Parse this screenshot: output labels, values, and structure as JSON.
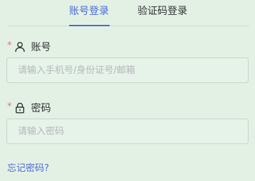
{
  "tabs": [
    {
      "label": "账号登录",
      "active": true
    },
    {
      "label": "验证码登录",
      "active": false
    }
  ],
  "form": {
    "account": {
      "required_mark": "*",
      "label": "账号",
      "icon": "user-icon",
      "placeholder": "请输入手机号/身份证号/邮箱",
      "value": ""
    },
    "password": {
      "required_mark": "*",
      "label": "密码",
      "icon": "lock-icon",
      "placeholder": "请输入密码",
      "value": ""
    }
  },
  "forgot_password": "忘记密码?",
  "colors": {
    "background": "#e3f1e5",
    "accent": "#4a6ad8",
    "required": "#f56c6c",
    "placeholder": "#b4b8bd",
    "border": "#c9d3cc"
  }
}
